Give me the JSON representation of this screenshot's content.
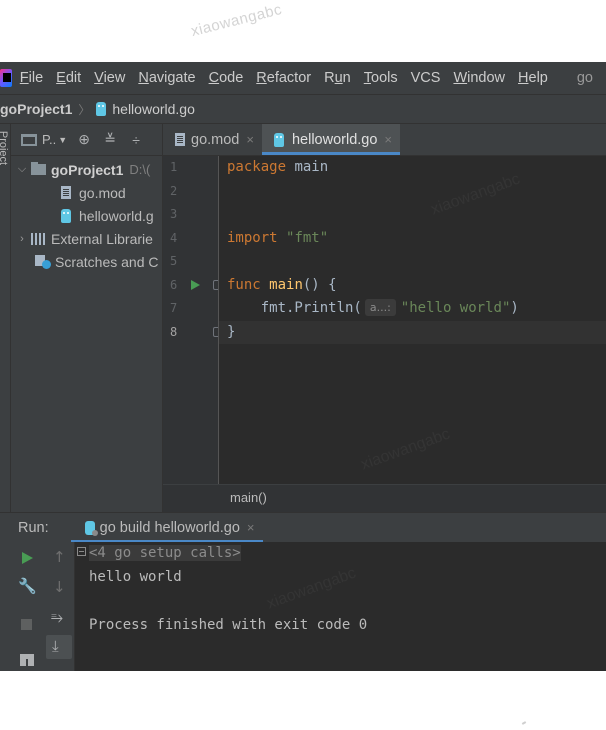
{
  "watermark": "xiaowangabc",
  "menu": {
    "items": [
      {
        "pre": "",
        "u": "F",
        "post": "ile"
      },
      {
        "pre": "",
        "u": "E",
        "post": "dit"
      },
      {
        "pre": "",
        "u": "V",
        "post": "iew"
      },
      {
        "pre": "",
        "u": "N",
        "post": "avigate"
      },
      {
        "pre": "",
        "u": "C",
        "post": "ode"
      },
      {
        "pre": "",
        "u": "R",
        "post": "efactor"
      },
      {
        "pre": "R",
        "u": "u",
        "post": "n"
      },
      {
        "pre": "",
        "u": "T",
        "post": "ools"
      },
      {
        "pre": "VCS",
        "u": "",
        "post": ""
      },
      {
        "pre": "",
        "u": "W",
        "post": "indow"
      },
      {
        "pre": "",
        "u": "H",
        "post": "elp"
      },
      {
        "pre": "go",
        "u": "",
        "post": ""
      }
    ]
  },
  "navbar": {
    "project": "goProject1",
    "file": "helloworld.go"
  },
  "toolstrip": {
    "label": "Project"
  },
  "project_panel": {
    "view_label": "P..",
    "tree": {
      "root": {
        "name": "goProject1",
        "path": "D:\\("
      },
      "files": [
        "go.mod",
        "helloworld.g"
      ],
      "external": "External Librarie",
      "scratches": "Scratches and C"
    }
  },
  "editor": {
    "tabs": [
      {
        "label": "go.mod",
        "close": "×"
      },
      {
        "label": "helloworld.go",
        "close": "×"
      }
    ],
    "line_numbers": [
      "1",
      "2",
      "3",
      "4",
      "5",
      "6",
      "7",
      "8"
    ],
    "code": {
      "l1_kw": "package",
      "l1_rest": " main",
      "l4_kw": "import",
      "l4_str": "\"fmt\"",
      "l6_kw": "func",
      "l6_fn": "main",
      "l6_rest": "() {",
      "l7_pre": "    fmt.Println(",
      "l7_hint": "a...:",
      "l7_str": "\"hello world\"",
      "l7_post": ")",
      "l8": "}"
    },
    "breadcrumb": "main()"
  },
  "run_panel": {
    "label": "Run:",
    "tab": {
      "label": "go build helloworld.go",
      "close": "×"
    },
    "console": {
      "setup_calls": "<4 go setup calls>",
      "line2": "hello world",
      "line4": "Process finished with exit code 0"
    }
  },
  "colors": {
    "editor_bg": "#2b2b2b",
    "panel_bg": "#3c3f41",
    "keyword": "#cc7832",
    "function": "#ffc66d",
    "string": "#6a8759",
    "tab_underline": "#4a88c7",
    "run_green": "#499c54"
  }
}
